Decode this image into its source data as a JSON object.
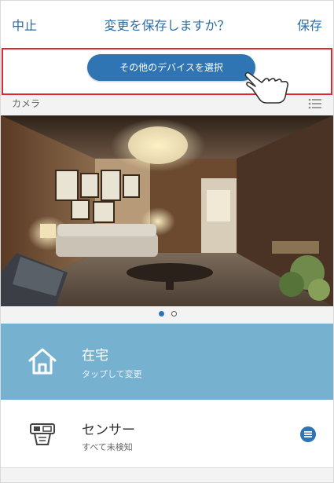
{
  "header": {
    "cancel_label": "中止",
    "title": "変更を保存しますか？",
    "save_label": "保存"
  },
  "select_device": {
    "label": "その他のデバイスを選択"
  },
  "camera": {
    "label": "カメラ"
  },
  "carousel": {
    "page": 1,
    "page_count": 2
  },
  "mode": {
    "title": "在宅",
    "subtitle": "タップして変更"
  },
  "sensor": {
    "title": "センサー",
    "subtitle": "すべて未検知"
  },
  "colors": {
    "accent": "#2f74b3",
    "mode_card": "#76b1cf",
    "highlight": "#e0262f"
  },
  "icons": {
    "home": "home-icon",
    "sensor": "sensor-device-icon",
    "list": "list-icon",
    "menu": "menu-circle-icon",
    "hand": "hand-pointer-icon"
  }
}
